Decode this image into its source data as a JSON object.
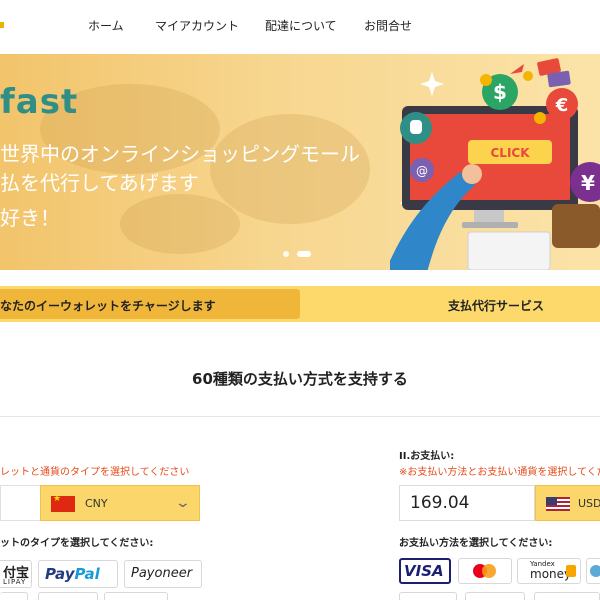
{
  "nav": {
    "items": [
      "ホーム",
      "マイアカウント",
      "配達について",
      "お問合せ"
    ]
  },
  "banner": {
    "brand": "fast",
    "line1": "世界中のオンラインショッピングモール",
    "line2": "払を代行してあげます",
    "line3": "好き！",
    "button_text": "CLICK",
    "slides": 2,
    "active_slide": 2
  },
  "tabs": {
    "tab1": "なたのイーウォレットをチャージします",
    "tab2": "支払代行サービス"
  },
  "section": {
    "title": "60種類の支払い方式を支持する"
  },
  "left": {
    "warning": "レットと通貨のタイプを選択してください",
    "currency_code": "CNY",
    "subheading": "ットのタイプを選択してください:",
    "ewallets": {
      "alipay_cn": "付宝",
      "alipay_en": "LIPAY",
      "paypal_a": "Pay",
      "paypal_b": "Pal",
      "payoneer": "Payoneer"
    }
  },
  "right": {
    "title": "II.お支払い:",
    "warning": "※お支払い方法とお支払い通貨を選択してください",
    "amount": "169.04",
    "currency_code": "USD",
    "subheading": "お支払い方法を選択してください:",
    "methods": {
      "visa": "VISA",
      "yandex_top": "Yandex",
      "yandex_bottom": "money"
    }
  },
  "colors": {
    "accent": "#fcd96a",
    "accent_active": "#f0b63a",
    "warning": "#e64a19",
    "brand": "#2f8f86"
  },
  "icons": {
    "chevron": "chevron-down-icon",
    "flag_cn": "flag-china-icon",
    "flag_us": "flag-usa-icon",
    "dollar": "dollar-coin-icon",
    "euro": "euro-coin-icon",
    "yen": "yen-coin-icon",
    "cursor": "hand-cursor-icon"
  }
}
